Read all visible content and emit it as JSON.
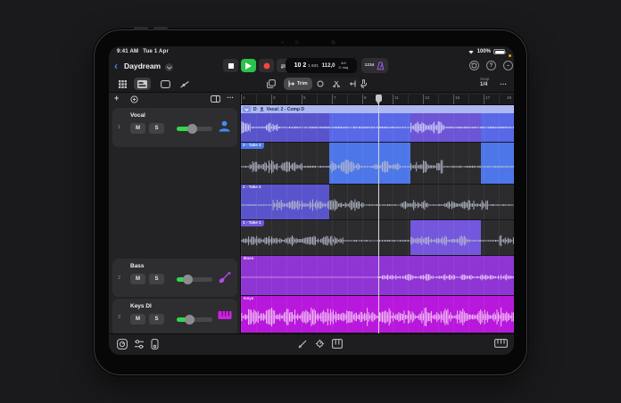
{
  "status_bar": {
    "time": "9:41 AM",
    "date": "Tue 1 Apr",
    "battery_percent": "100%"
  },
  "toolbar": {
    "project_title": "Daydream",
    "lcd": {
      "position_bars": "10 2",
      "position_sub": "1 631",
      "tempo": "112,0",
      "time_signature": "4/4",
      "key": "C maj"
    },
    "count_in": "1234",
    "help_glyph": "?",
    "minimize_glyph": "–"
  },
  "view_bar": {
    "trim_label": "Trim",
    "snap_label": "Snap",
    "snap_value": "1/4",
    "more_glyph": "…"
  },
  "track_header": {
    "add_glyph": "+",
    "more_glyph": "…"
  },
  "tracks": [
    {
      "number": "1",
      "name": "Vocal",
      "mute": "M",
      "solo": "S",
      "icon": "vocalist-icon",
      "volume_percent": 42
    },
    {
      "number": "2",
      "name": "Bass",
      "mute": "M",
      "solo": "S",
      "icon": "bass-guitar-icon",
      "volume_percent": 28
    },
    {
      "number": "3",
      "name": "Keys DI",
      "mute": "M",
      "solo": "S",
      "icon": "keys-keyboard-icon",
      "volume_percent": 35
    }
  ],
  "ruler": {
    "bars": [
      "1",
      "3",
      "5",
      "7",
      "9",
      "11",
      "13",
      "15",
      "17",
      "19"
    ]
  },
  "arrange": {
    "comp_region": {
      "badge": "D",
      "label": "Vocal: 2 - Comp D"
    },
    "takes": [
      {
        "label": "3 - Take 3"
      },
      {
        "label": "2 - Take 2"
      },
      {
        "label": "1 - Take 1"
      }
    ],
    "bass_region_label": "Bass",
    "keys_region_label": "Keys"
  },
  "colors": {
    "accent_blue": "#3e82f7",
    "play_green": "#2bc24a",
    "record_red": "#ff453a",
    "metronome_purple": "#a35ce8",
    "take3_blue": "#4d76e8",
    "take2_indigo": "#5a54cc",
    "take1_violet": "#7457dc",
    "bass_purple": "#8f35d4",
    "keys_magenta": "#b818dc",
    "slider_green": "#32d74b"
  }
}
